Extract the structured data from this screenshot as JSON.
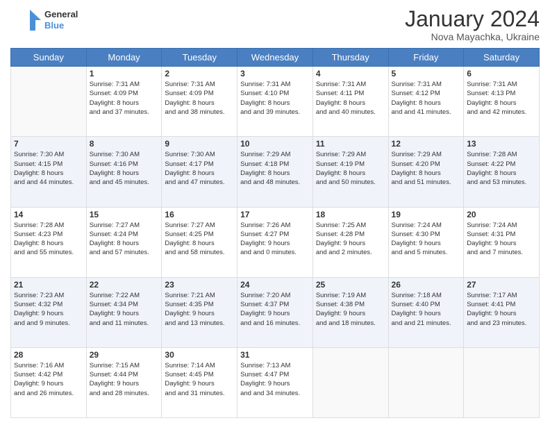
{
  "header": {
    "logo_line1": "General",
    "logo_line2": "Blue",
    "month_title": "January 2024",
    "location": "Nova Mayachka, Ukraine"
  },
  "weekdays": [
    "Sunday",
    "Monday",
    "Tuesday",
    "Wednesday",
    "Thursday",
    "Friday",
    "Saturday"
  ],
  "weeks": [
    [
      {
        "day": "",
        "sunrise": "",
        "sunset": "",
        "daylight": ""
      },
      {
        "day": "1",
        "sunrise": "Sunrise: 7:31 AM",
        "sunset": "Sunset: 4:09 PM",
        "daylight": "Daylight: 8 hours and 37 minutes."
      },
      {
        "day": "2",
        "sunrise": "Sunrise: 7:31 AM",
        "sunset": "Sunset: 4:09 PM",
        "daylight": "Daylight: 8 hours and 38 minutes."
      },
      {
        "day": "3",
        "sunrise": "Sunrise: 7:31 AM",
        "sunset": "Sunset: 4:10 PM",
        "daylight": "Daylight: 8 hours and 39 minutes."
      },
      {
        "day": "4",
        "sunrise": "Sunrise: 7:31 AM",
        "sunset": "Sunset: 4:11 PM",
        "daylight": "Daylight: 8 hours and 40 minutes."
      },
      {
        "day": "5",
        "sunrise": "Sunrise: 7:31 AM",
        "sunset": "Sunset: 4:12 PM",
        "daylight": "Daylight: 8 hours and 41 minutes."
      },
      {
        "day": "6",
        "sunrise": "Sunrise: 7:31 AM",
        "sunset": "Sunset: 4:13 PM",
        "daylight": "Daylight: 8 hours and 42 minutes."
      }
    ],
    [
      {
        "day": "7",
        "sunrise": "Sunrise: 7:30 AM",
        "sunset": "Sunset: 4:15 PM",
        "daylight": "Daylight: 8 hours and 44 minutes."
      },
      {
        "day": "8",
        "sunrise": "Sunrise: 7:30 AM",
        "sunset": "Sunset: 4:16 PM",
        "daylight": "Daylight: 8 hours and 45 minutes."
      },
      {
        "day": "9",
        "sunrise": "Sunrise: 7:30 AM",
        "sunset": "Sunset: 4:17 PM",
        "daylight": "Daylight: 8 hours and 47 minutes."
      },
      {
        "day": "10",
        "sunrise": "Sunrise: 7:29 AM",
        "sunset": "Sunset: 4:18 PM",
        "daylight": "Daylight: 8 hours and 48 minutes."
      },
      {
        "day": "11",
        "sunrise": "Sunrise: 7:29 AM",
        "sunset": "Sunset: 4:19 PM",
        "daylight": "Daylight: 8 hours and 50 minutes."
      },
      {
        "day": "12",
        "sunrise": "Sunrise: 7:29 AM",
        "sunset": "Sunset: 4:20 PM",
        "daylight": "Daylight: 8 hours and 51 minutes."
      },
      {
        "day": "13",
        "sunrise": "Sunrise: 7:28 AM",
        "sunset": "Sunset: 4:22 PM",
        "daylight": "Daylight: 8 hours and 53 minutes."
      }
    ],
    [
      {
        "day": "14",
        "sunrise": "Sunrise: 7:28 AM",
        "sunset": "Sunset: 4:23 PM",
        "daylight": "Daylight: 8 hours and 55 minutes."
      },
      {
        "day": "15",
        "sunrise": "Sunrise: 7:27 AM",
        "sunset": "Sunset: 4:24 PM",
        "daylight": "Daylight: 8 hours and 57 minutes."
      },
      {
        "day": "16",
        "sunrise": "Sunrise: 7:27 AM",
        "sunset": "Sunset: 4:25 PM",
        "daylight": "Daylight: 8 hours and 58 minutes."
      },
      {
        "day": "17",
        "sunrise": "Sunrise: 7:26 AM",
        "sunset": "Sunset: 4:27 PM",
        "daylight": "Daylight: 9 hours and 0 minutes."
      },
      {
        "day": "18",
        "sunrise": "Sunrise: 7:25 AM",
        "sunset": "Sunset: 4:28 PM",
        "daylight": "Daylight: 9 hours and 2 minutes."
      },
      {
        "day": "19",
        "sunrise": "Sunrise: 7:24 AM",
        "sunset": "Sunset: 4:30 PM",
        "daylight": "Daylight: 9 hours and 5 minutes."
      },
      {
        "day": "20",
        "sunrise": "Sunrise: 7:24 AM",
        "sunset": "Sunset: 4:31 PM",
        "daylight": "Daylight: 9 hours and 7 minutes."
      }
    ],
    [
      {
        "day": "21",
        "sunrise": "Sunrise: 7:23 AM",
        "sunset": "Sunset: 4:32 PM",
        "daylight": "Daylight: 9 hours and 9 minutes."
      },
      {
        "day": "22",
        "sunrise": "Sunrise: 7:22 AM",
        "sunset": "Sunset: 4:34 PM",
        "daylight": "Daylight: 9 hours and 11 minutes."
      },
      {
        "day": "23",
        "sunrise": "Sunrise: 7:21 AM",
        "sunset": "Sunset: 4:35 PM",
        "daylight": "Daylight: 9 hours and 13 minutes."
      },
      {
        "day": "24",
        "sunrise": "Sunrise: 7:20 AM",
        "sunset": "Sunset: 4:37 PM",
        "daylight": "Daylight: 9 hours and 16 minutes."
      },
      {
        "day": "25",
        "sunrise": "Sunrise: 7:19 AM",
        "sunset": "Sunset: 4:38 PM",
        "daylight": "Daylight: 9 hours and 18 minutes."
      },
      {
        "day": "26",
        "sunrise": "Sunrise: 7:18 AM",
        "sunset": "Sunset: 4:40 PM",
        "daylight": "Daylight: 9 hours and 21 minutes."
      },
      {
        "day": "27",
        "sunrise": "Sunrise: 7:17 AM",
        "sunset": "Sunset: 4:41 PM",
        "daylight": "Daylight: 9 hours and 23 minutes."
      }
    ],
    [
      {
        "day": "28",
        "sunrise": "Sunrise: 7:16 AM",
        "sunset": "Sunset: 4:42 PM",
        "daylight": "Daylight: 9 hours and 26 minutes."
      },
      {
        "day": "29",
        "sunrise": "Sunrise: 7:15 AM",
        "sunset": "Sunset: 4:44 PM",
        "daylight": "Daylight: 9 hours and 28 minutes."
      },
      {
        "day": "30",
        "sunrise": "Sunrise: 7:14 AM",
        "sunset": "Sunset: 4:45 PM",
        "daylight": "Daylight: 9 hours and 31 minutes."
      },
      {
        "day": "31",
        "sunrise": "Sunrise: 7:13 AM",
        "sunset": "Sunset: 4:47 PM",
        "daylight": "Daylight: 9 hours and 34 minutes."
      },
      {
        "day": "",
        "sunrise": "",
        "sunset": "",
        "daylight": ""
      },
      {
        "day": "",
        "sunrise": "",
        "sunset": "",
        "daylight": ""
      },
      {
        "day": "",
        "sunrise": "",
        "sunset": "",
        "daylight": ""
      }
    ]
  ]
}
